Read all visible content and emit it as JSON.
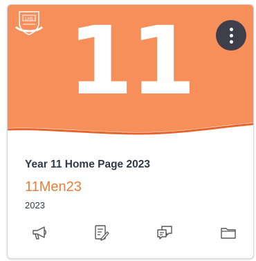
{
  "card": {
    "hero_color": "#f78f5a",
    "hero_number": "11",
    "title": "Year 11 Home Page 2023",
    "course_code": "11Men23",
    "term": "2023",
    "accent_color": "#e87e37",
    "logo_text": "LHS",
    "menu_icon": "more-vertical-icon"
  },
  "actions": [
    {
      "name": "announcements-icon"
    },
    {
      "name": "assignments-icon"
    },
    {
      "name": "discussions-icon"
    },
    {
      "name": "files-icon"
    }
  ]
}
